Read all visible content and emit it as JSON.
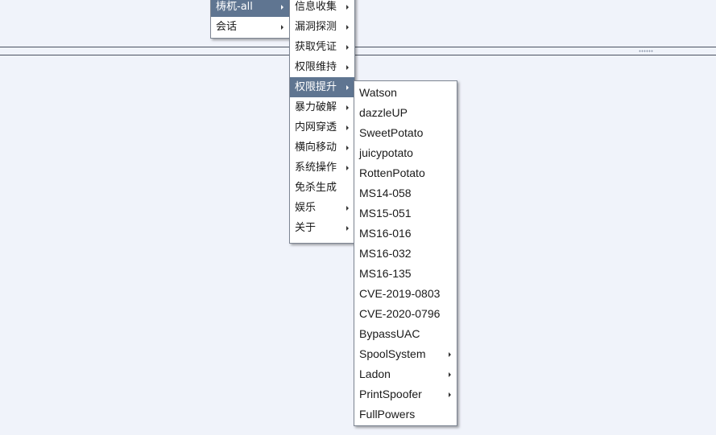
{
  "menu_level1": [
    {
      "label": "梼杌-all",
      "selected": true,
      "submenu": true
    },
    {
      "label": "会话",
      "selected": false,
      "submenu": true
    }
  ],
  "menu_level2": [
    {
      "label": "信息收集",
      "submenu": true
    },
    {
      "label": "漏洞探测",
      "submenu": true
    },
    {
      "label": "获取凭证",
      "submenu": true
    },
    {
      "label": "权限维持",
      "submenu": true
    },
    {
      "label": "权限提升",
      "submenu": true,
      "selected": true
    },
    {
      "label": "暴力破解",
      "submenu": true
    },
    {
      "label": "内网穿透",
      "submenu": true
    },
    {
      "label": "横向移动",
      "submenu": true
    },
    {
      "label": "系统操作",
      "submenu": true
    },
    {
      "label": "免杀生成",
      "submenu": false
    },
    {
      "label": "娱乐",
      "submenu": true
    },
    {
      "label": "关于",
      "submenu": true
    }
  ],
  "menu_level3": [
    {
      "label": "Watson",
      "submenu": false
    },
    {
      "label": "dazzleUP",
      "submenu": false
    },
    {
      "label": "SweetPotato",
      "submenu": false
    },
    {
      "label": "juicypotato",
      "submenu": false
    },
    {
      "label": "RottenPotato",
      "submenu": false
    },
    {
      "label": "MS14-058",
      "submenu": false
    },
    {
      "label": "MS15-051",
      "submenu": false
    },
    {
      "label": "MS16-016",
      "submenu": false
    },
    {
      "label": "MS16-032",
      "submenu": false
    },
    {
      "label": "MS16-135",
      "submenu": false
    },
    {
      "label": "CVE-2019-0803",
      "submenu": false
    },
    {
      "label": "CVE-2020-0796",
      "submenu": false
    },
    {
      "label": "BypassUAC",
      "submenu": false
    },
    {
      "label": "SpoolSystem",
      "submenu": true
    },
    {
      "label": "Ladon",
      "submenu": true
    },
    {
      "label": "PrintSpoofer",
      "submenu": true
    },
    {
      "label": "FullPowers",
      "submenu": false
    }
  ],
  "colors": {
    "background": "#f0f3fa",
    "selected": "#5f7591",
    "menu_border": "#7d8592"
  }
}
